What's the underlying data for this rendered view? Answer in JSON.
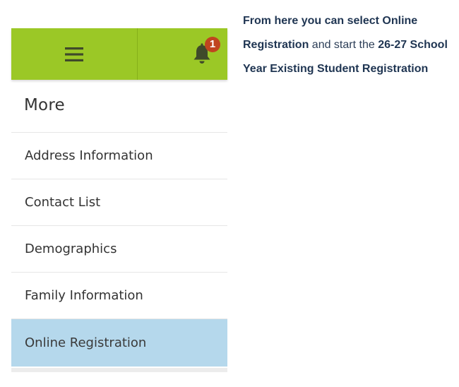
{
  "topbar": {
    "menu_icon": "hamburger-menu-icon",
    "bell_icon": "bell-icon",
    "notification_count": "1",
    "bar_color": "#9bc826",
    "badge_color": "#c0451f"
  },
  "page": {
    "title": "More"
  },
  "menu": {
    "items": [
      {
        "label": "Address Information",
        "active": false
      },
      {
        "label": "Contact List",
        "active": false
      },
      {
        "label": "Demographics",
        "active": false
      },
      {
        "label": "Family Information",
        "active": false
      },
      {
        "label": "Online Registration",
        "active": true
      }
    ],
    "active_color": "#b5d8ec"
  },
  "instruction": {
    "part1": "From here you can select Online Registration",
    "part2": " and start the ",
    "part3": "26-27 School Year Existing Student Registration"
  }
}
